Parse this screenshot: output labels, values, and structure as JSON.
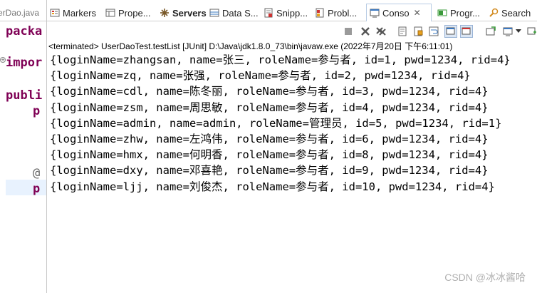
{
  "editor": {
    "tab_label": "erDao.java",
    "code_lines": [
      "packa",
      "impor",
      "publi",
      "p",
      "@",
      "p"
    ]
  },
  "tabs": [
    {
      "label": "Markers",
      "icon": "markers-icon"
    },
    {
      "label": "Prope...",
      "icon": "properties-icon"
    },
    {
      "label": "Servers",
      "icon": "servers-icon"
    },
    {
      "label": "Data S...",
      "icon": "data-source-icon"
    },
    {
      "label": "Snipp...",
      "icon": "snippets-icon"
    },
    {
      "label": "Probl...",
      "icon": "problems-icon"
    },
    {
      "label": "Conso",
      "icon": "console-icon"
    },
    {
      "label": "Progr...",
      "icon": "progress-icon"
    },
    {
      "label": "Search",
      "icon": "search-icon"
    }
  ],
  "console": {
    "header": "<terminated> UserDaoTest.testList [JUnit] D:\\Java\\jdk1.8.0_73\\bin\\javaw.exe (2022年7月20日 下午6:11:01)",
    "lines": [
      "{loginName=zhangsan, name=张三, roleName=参与者, id=1, pwd=1234, rid=4}",
      "{loginName=zq, name=张强, roleName=参与者, id=2, pwd=1234, rid=4}",
      "{loginName=cdl, name=陈冬丽, roleName=参与者, id=3, pwd=1234, rid=4}",
      "{loginName=zsm, name=周思敏, roleName=参与者, id=4, pwd=1234, rid=4}",
      "{loginName=admin, name=admin, roleName=管理员, id=5, pwd=1234, rid=1}",
      "{loginName=zhw, name=左鸿伟, roleName=参与者, id=6, pwd=1234, rid=4}",
      "{loginName=hmx, name=何明香, roleName=参与者, id=8, pwd=1234, rid=4}",
      "{loginName=dxy, name=邓喜艳, roleName=参与者, id=9, pwd=1234, rid=4}",
      "{loginName=ljj, name=刘俊杰, roleName=参与者, id=10, pwd=1234, rid=4}"
    ]
  },
  "watermark": "CSDN @冰冰酱哈",
  "colors": {
    "keyword": "#7f0055",
    "active_tab_border": "#b8cce4"
  }
}
